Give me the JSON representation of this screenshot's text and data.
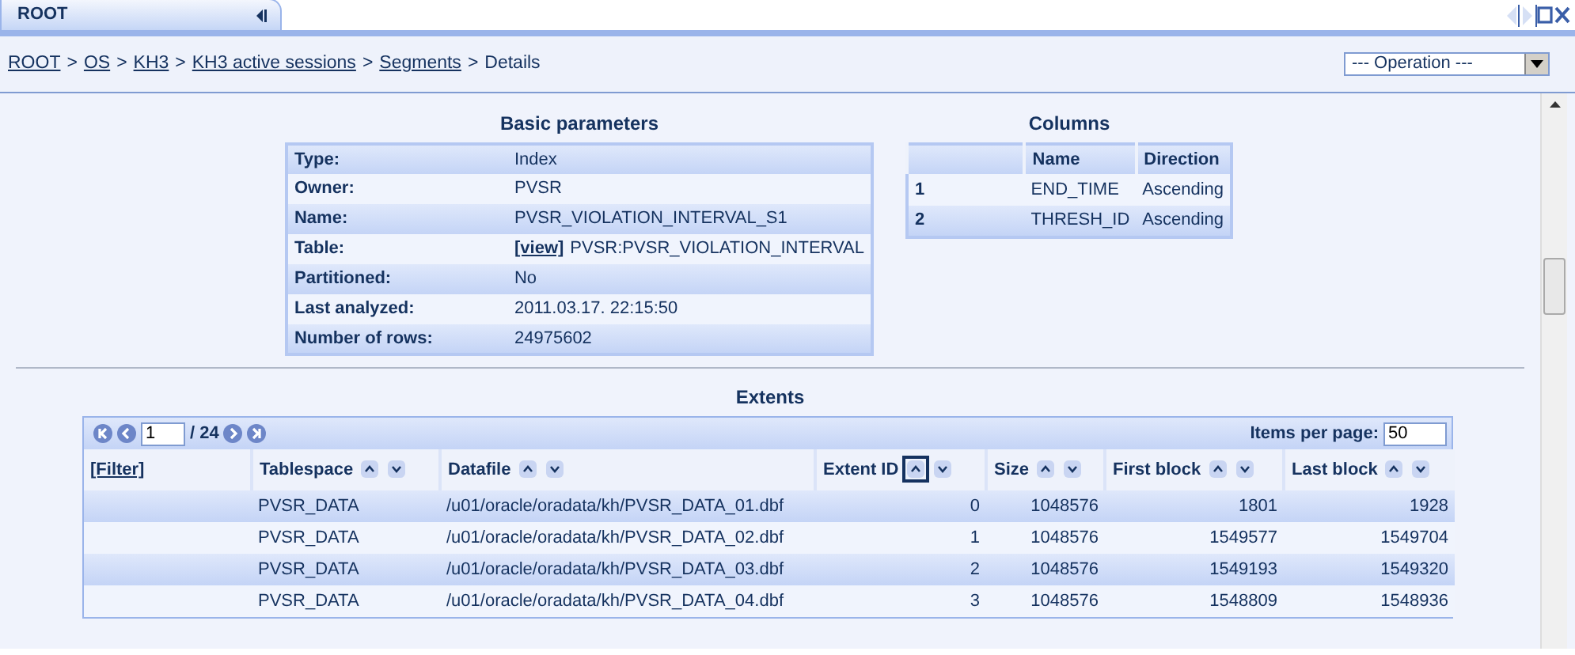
{
  "tab": {
    "label": "ROOT"
  },
  "breadcrumb": [
    {
      "label": "ROOT",
      "link": true
    },
    {
      "label": "OS",
      "link": true
    },
    {
      "label": "KH3",
      "link": true
    },
    {
      "label": "KH3 active sessions",
      "link": true
    },
    {
      "label": "Segments",
      "link": true
    },
    {
      "label": "Details",
      "link": false
    }
  ],
  "breadcrumb_separator": ">",
  "operation_select": {
    "value": "--- Operation ---"
  },
  "basic_parameters": {
    "title": "Basic parameters",
    "rows": [
      {
        "label": "Type:",
        "value": "Index"
      },
      {
        "label": "Owner:",
        "value": "PVSR"
      },
      {
        "label": "Name:",
        "value": "PVSR_VIOLATION_INTERVAL_S1"
      },
      {
        "label": "Table:",
        "link": "[view]",
        "value": "PVSR:PVSR_VIOLATION_INTERVAL"
      },
      {
        "label": "Partitioned:",
        "value": "No"
      },
      {
        "label": "Last analyzed:",
        "value": "2011.03.17. 22:15:50"
      },
      {
        "label": "Number of rows:",
        "value": "24975602"
      }
    ]
  },
  "columns_table": {
    "title": "Columns",
    "columns": [
      "",
      "Name",
      "Direction"
    ],
    "rows": [
      [
        "1",
        "END_TIME",
        "Ascending"
      ],
      [
        "2",
        "THRESH_ID",
        "Ascending"
      ]
    ]
  },
  "extents": {
    "title": "Extents",
    "page": "1",
    "page_count": "/ 24",
    "items_per_page_label": "Items per page:",
    "items_per_page": "50",
    "columns": [
      {
        "label": "[Filter]",
        "kind": "filter"
      },
      {
        "label": "Tablespace",
        "kind": "sortable",
        "numeric": false,
        "sorted_ascending": false
      },
      {
        "label": "Datafile",
        "kind": "sortable",
        "numeric": false,
        "sorted_ascending": false
      },
      {
        "label": "Extent ID",
        "kind": "sortable",
        "numeric": true,
        "sorted_ascending": true
      },
      {
        "label": "Size",
        "kind": "sortable",
        "numeric": true,
        "sorted_ascending": false
      },
      {
        "label": "First block",
        "kind": "sortable",
        "numeric": true,
        "sorted_ascending": false
      },
      {
        "label": "Last block",
        "kind": "sortable",
        "numeric": true,
        "sorted_ascending": false
      }
    ],
    "rows": [
      [
        "",
        "PVSR_DATA",
        "/u01/oracle/oradata/kh/PVSR_DATA_01.dbf",
        "0",
        "1048576",
        "1801",
        "1928"
      ],
      [
        "",
        "PVSR_DATA",
        "/u01/oracle/oradata/kh/PVSR_DATA_02.dbf",
        "1",
        "1048576",
        "1549577",
        "1549704"
      ],
      [
        "",
        "PVSR_DATA",
        "/u01/oracle/oradata/kh/PVSR_DATA_03.dbf",
        "2",
        "1048576",
        "1549193",
        "1549320"
      ],
      [
        "",
        "PVSR_DATA",
        "/u01/oracle/oradata/kh/PVSR_DATA_04.dbf",
        "3",
        "1048576",
        "1548809",
        "1548936"
      ]
    ]
  }
}
